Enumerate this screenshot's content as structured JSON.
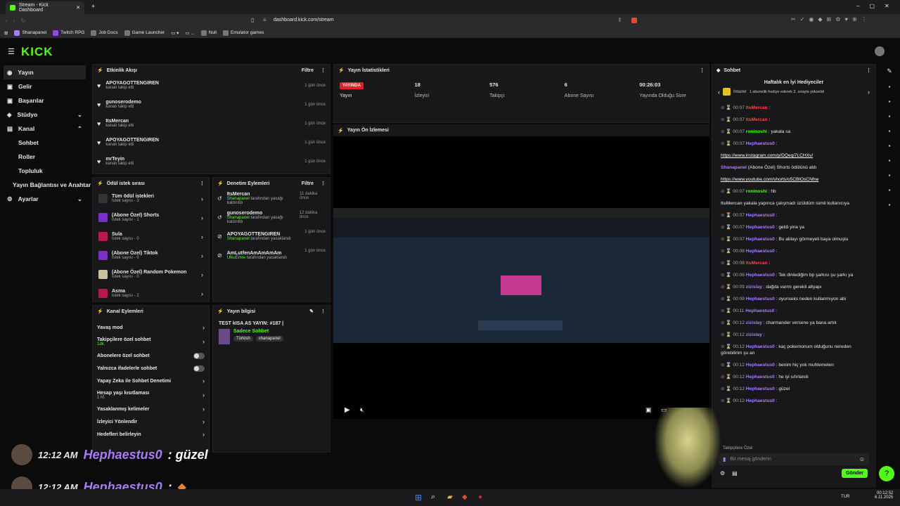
{
  "browser": {
    "tab_title": "Stream - Kick Dashboard",
    "url": "dashboard.kick.com/stream",
    "bookmarks": [
      "Shanapanel",
      "Twitch RPG",
      "Job Docs",
      "Game Launcher",
      "Null",
      "Emulator games"
    ]
  },
  "brand": {
    "logo": "KICK",
    "accent": "#53fc18"
  },
  "sidebar": {
    "items": [
      "Yayın",
      "Gelir",
      "Başarılar",
      "Stüdyo",
      "Kanal",
      "Sohbet",
      "Roller",
      "Topluluk",
      "Yayın Bağlantısı ve Anahtar",
      "Ayarlar"
    ]
  },
  "activity": {
    "title": "Etkinlik Akışı",
    "filter": "Filtre",
    "items": [
      {
        "name": "APOYAGOTTENGIREN",
        "sub": "kanalı takip etti",
        "time": "1 gün önce"
      },
      {
        "name": "gunoserodemo",
        "sub": "kanalı takip etti",
        "time": "1 gün önce"
      },
      {
        "name": "ItsMercan",
        "sub": "kanalı takip etti",
        "time": "1 gün önce"
      },
      {
        "name": "APOYAGOTTENGIREN",
        "sub": "kanalı takip etti",
        "time": "1 gün önce"
      },
      {
        "name": "mrTeyin",
        "sub": "kanalı takip etti",
        "time": "1 gün önce"
      }
    ]
  },
  "stats": {
    "title": "Yayın İstatistikleri",
    "live": "YAYINDA",
    "items": [
      {
        "value": "",
        "label": "Yayın"
      },
      {
        "value": "18",
        "label": "İzleyici"
      },
      {
        "value": "576",
        "label": "Takipçi"
      },
      {
        "value": "6",
        "label": "Abone Sayısı"
      },
      {
        "value": "00:26:03",
        "label": "Yayında Olduğu Süre"
      }
    ]
  },
  "preview": {
    "title": "Yayın Ön İzlemesi"
  },
  "rewards": {
    "title": "Ödül istek sırası",
    "items": [
      {
        "name": "Tüm ödül istekleri",
        "sub": "İstek sayısı - 3"
      },
      {
        "name": "(Abone Özel) Shorts",
        "sub": "İstek sayısı - 1"
      },
      {
        "name": "Sula",
        "sub": "İstek sayısı - 0"
      },
      {
        "name": "(Abone Özel) Tiktok",
        "sub": "İstek sayısı - 0"
      },
      {
        "name": "(Abone Özel) Random Pokemon",
        "sub": "İstek sayısı - 0"
      },
      {
        "name": "Asma",
        "sub": "İstek sayısı - 2"
      }
    ]
  },
  "moderation": {
    "title": "Denetim Eylemleri",
    "filter": "Filtre",
    "items": [
      {
        "name": "ItsMercan",
        "by": "Shanapanel",
        "action": "tarafından yasağı kaldırıldı",
        "time": "11 dakika önce"
      },
      {
        "name": "gunoserodemo",
        "by": "Shanapanel",
        "action": "tarafından yasağı kaldırıldı",
        "time": "12 dakika önce"
      },
      {
        "name": "APOYAGOTTENGIREN",
        "by": "Shanapanel",
        "action": "tarafından yasaklandı",
        "time": "1 gün önce"
      },
      {
        "name": "AmLutfenAmAmAmAm",
        "by": "UlkuEmre",
        "action": "tarafından yasaklandı",
        "time": "1 gün önce"
      }
    ]
  },
  "channel_actions": {
    "title": "Kanal Eylemleri",
    "items": [
      {
        "label": "Yavaş mod",
        "sub": ""
      },
      {
        "label": "Takipçilere özel sohbet",
        "sub": "1dk."
      },
      {
        "label": "Abonelere özel sohbet",
        "sub": ""
      },
      {
        "label": "Yalnızca ifadelerle sohbet",
        "sub": ""
      },
      {
        "label": "Yapay Zeka ile Sohbet Denetimi",
        "sub": ""
      },
      {
        "label": "Hesap yaşı kısıtlaması",
        "sub": "1 hf."
      },
      {
        "label": "Yasaklanmış kelimeler",
        "sub": ""
      },
      {
        "label": "İzleyici Yönlendir",
        "sub": ""
      },
      {
        "label": "Hedefleri belirleyin",
        "sub": ""
      }
    ]
  },
  "stream_info": {
    "title": "Yayın bilgisi",
    "stream_title": "TEST kISA AS YAYIN: #187 |",
    "category": "Sadece Sohbet",
    "tags": [
      "Türkish",
      "shanapanel"
    ]
  },
  "chat": {
    "title": "Sohbet",
    "gifters_title": "Haftalık en İyi Hediyeciler",
    "top_gifter": "Insurer",
    "gifter_note": "1 abonelik hediye ederek 2. sırayla yükseldi",
    "input_placeholder": "Bir mesaj gönderin",
    "send": "Gönder",
    "followers_only": "Takipçilere Özel",
    "messages": [
      {
        "t": "00:07",
        "u": "ItsMercan",
        "c": "red",
        "m": ":"
      },
      {
        "t": "00:07",
        "u": "ItsMercan",
        "c": "red",
        "m": ":"
      },
      {
        "t": "00:07",
        "u": "roninoshi",
        "c": "green",
        "m": ": yakala sa"
      },
      {
        "t": "00:07",
        "u": "Hephaestus0",
        "c": "purple",
        "m": ":"
      },
      {
        "t": "",
        "u": "",
        "c": "",
        "m": "https://www.instagram.com/p/DQeqi7LCHXv/"
      },
      {
        "t": "",
        "u": "Shanapanel",
        "c": "purple",
        "m": "(Abone Özel) Shorts ödülünü aldı"
      },
      {
        "t": "",
        "u": "",
        "c": "",
        "m": "https://www.youtube.com/shorts/o5CBlOsCNhw"
      },
      {
        "t": "00:07",
        "u": "roninoshi",
        "c": "green",
        "m": ": hb"
      },
      {
        "t": "",
        "u": "ItsMercan",
        "c": "",
        "m": "yakala yapınca çalışmadı üzüldüm isimli kullanıcıya"
      },
      {
        "t": "00:07",
        "u": "Hephaestus0",
        "c": "purple",
        "m": ":"
      },
      {
        "t": "00:07",
        "u": "Hephaestus0",
        "c": "purple",
        "m": ": geldi yine ya"
      },
      {
        "t": "00:07",
        "u": "Hephaestus0",
        "c": "purple",
        "m": ": Bu ablayı görmeyeli baya olmuştu"
      },
      {
        "t": "00:08",
        "u": "Hephaestus0",
        "c": "purple",
        "m": ":"
      },
      {
        "t": "00:08",
        "u": "ItsMercan",
        "c": "red",
        "m": ":"
      },
      {
        "t": "00:08",
        "u": "Hephaestus0",
        "c": "purple",
        "m": ": Tek dinlediğim bp şarkısı şu şarkı ya"
      },
      {
        "t": "00:09",
        "u": "zizislay",
        "c": "purple",
        "m": ": dağda varmı gerekli altyapı"
      },
      {
        "t": "00:09",
        "u": "Hephaestus0",
        "c": "purple",
        "m": ": oyunseks neden kullanmıyon abi"
      },
      {
        "t": "00:11",
        "u": "Hephaestus0",
        "c": "purple",
        "m": ":"
      },
      {
        "t": "00:12",
        "u": "zizislay",
        "c": "purple",
        "m": ": charmander versene ya bana artık"
      },
      {
        "t": "00:12",
        "u": "zizislay",
        "c": "purple",
        "m": ":"
      },
      {
        "t": "00:12",
        "u": "Hephaestus0",
        "c": "purple",
        "m": ": kaç pokemonum olduğunu nereden görebilirim şu an"
      },
      {
        "t": "00:12",
        "u": "Hephaestus0",
        "c": "purple",
        "m": ": benim hiç yok muhtemelen"
      },
      {
        "t": "00:12",
        "u": "Hephaestus0",
        "c": "purple",
        "m": ": he iyi sıfırlandı"
      },
      {
        "t": "00:12",
        "u": "Hephaestus0",
        "c": "purple",
        "m": ": güzel"
      },
      {
        "t": "00:12",
        "u": "Hephaestus0",
        "c": "purple",
        "m": ":"
      }
    ]
  },
  "overlay": {
    "lines": [
      {
        "time": "12:12 AM",
        "name": "Hephaestus0",
        "msg": ": güzel"
      },
      {
        "time": "12:12 AM",
        "name": "Hephaestus0",
        "msg": ":"
      }
    ]
  },
  "taskbar": {
    "lang": "TUR",
    "time": "00:12:52",
    "date": "6.11.2025"
  }
}
